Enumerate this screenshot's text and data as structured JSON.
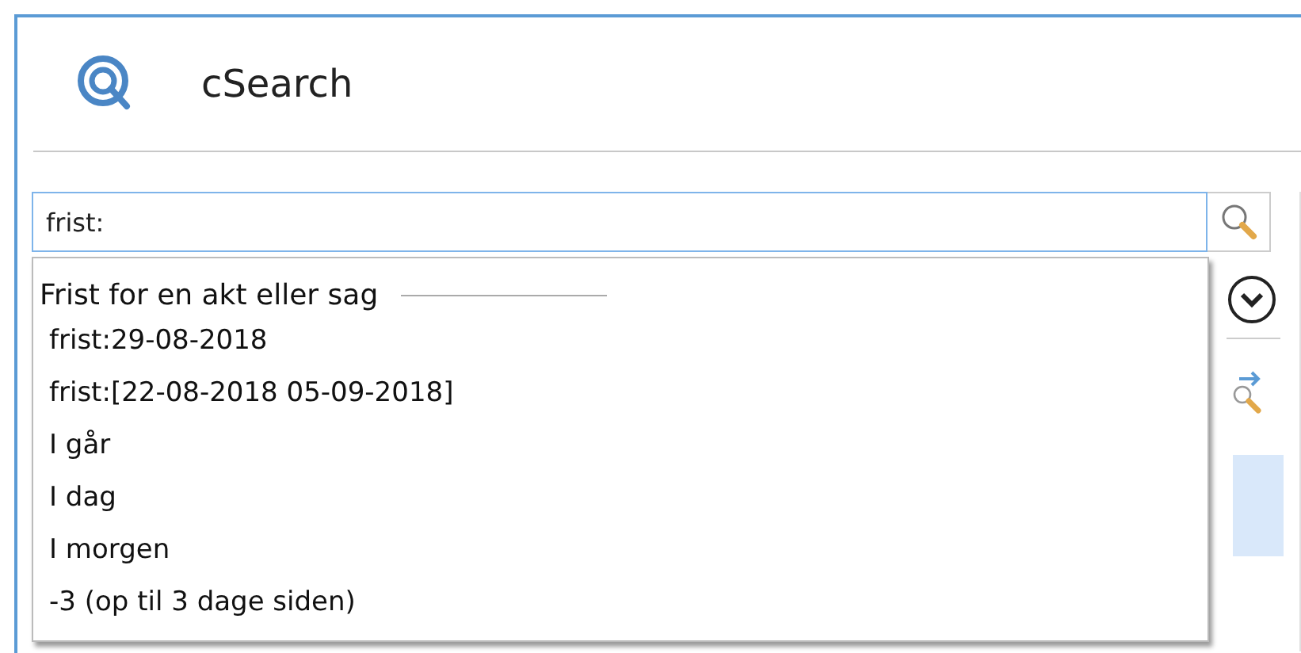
{
  "app": {
    "title": "cSearch"
  },
  "search": {
    "value": "frist:"
  },
  "suggestions": {
    "heading": "Frist for en akt eller sag",
    "items": [
      {
        "label": "frist:29-08-2018"
      },
      {
        "label": "frist:[22-08-2018 05-09-2018]"
      },
      {
        "label": "I går"
      },
      {
        "label": "I dag"
      },
      {
        "label": "I morgen"
      },
      {
        "label": "-3 (op til 3 dage siden)"
      }
    ]
  }
}
